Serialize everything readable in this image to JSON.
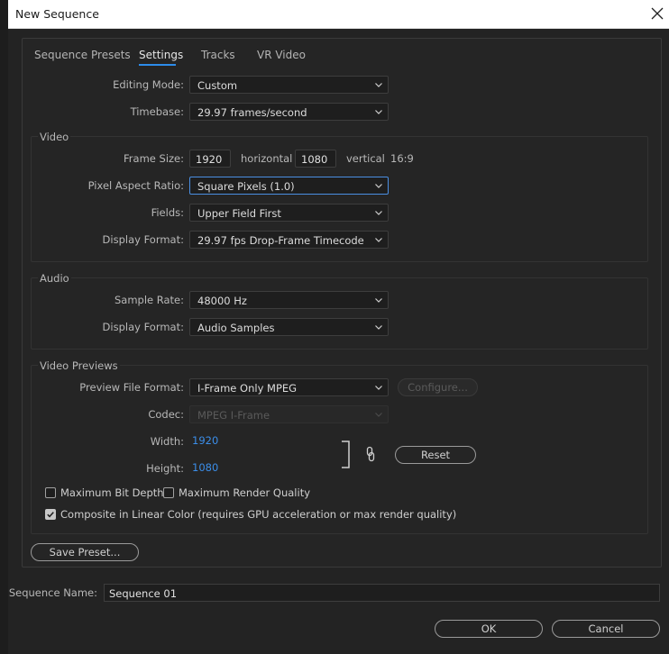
{
  "window": {
    "title": "New Sequence"
  },
  "tabs": [
    {
      "label": "Sequence Presets"
    },
    {
      "label": "Settings"
    },
    {
      "label": "Tracks"
    },
    {
      "label": "VR Video"
    }
  ],
  "settings": {
    "editing_mode": {
      "label": "Editing Mode:",
      "value": "Custom"
    },
    "timebase": {
      "label": "Timebase:",
      "value": "29.97  frames/second"
    }
  },
  "video": {
    "group_label": "Video",
    "frame_size": {
      "label": "Frame Size:",
      "width": "1920",
      "width_unit": "horizontal",
      "height": "1080",
      "height_unit": "vertical",
      "aspect": "16:9"
    },
    "pixel_aspect": {
      "label": "Pixel Aspect Ratio:",
      "value": "Square Pixels (1.0)"
    },
    "fields": {
      "label": "Fields:",
      "value": "Upper Field First"
    },
    "display_format": {
      "label": "Display Format:",
      "value": "29.97 fps Drop-Frame Timecode"
    }
  },
  "audio": {
    "group_label": "Audio",
    "sample_rate": {
      "label": "Sample Rate:",
      "value": "48000 Hz"
    },
    "display_format": {
      "label": "Display Format:",
      "value": "Audio Samples"
    }
  },
  "previews": {
    "group_label": "Video Previews",
    "file_format": {
      "label": "Preview File Format:",
      "value": "I-Frame Only MPEG"
    },
    "configure_label": "Configure...",
    "codec": {
      "label": "Codec:",
      "value": "MPEG I-Frame"
    },
    "width": {
      "label": "Width:",
      "value": "1920"
    },
    "height": {
      "label": "Height:",
      "value": "1080"
    },
    "reset_label": "Reset"
  },
  "options": {
    "max_bit_depth": {
      "label": "Maximum Bit Depth",
      "checked": false
    },
    "max_render_quality": {
      "label": "Maximum Render Quality",
      "checked": false
    },
    "linear_color": {
      "label": "Composite in Linear Color (requires GPU acceleration or max render quality)",
      "checked": true
    }
  },
  "save_preset_label": "Save Preset...",
  "sequence_name": {
    "label": "Sequence Name:",
    "value": "Sequence 01"
  },
  "buttons": {
    "ok": "OK",
    "cancel": "Cancel"
  },
  "colors": {
    "accent": "#2d8ceb",
    "link_value": "#3b8eea",
    "background": "#232323"
  }
}
